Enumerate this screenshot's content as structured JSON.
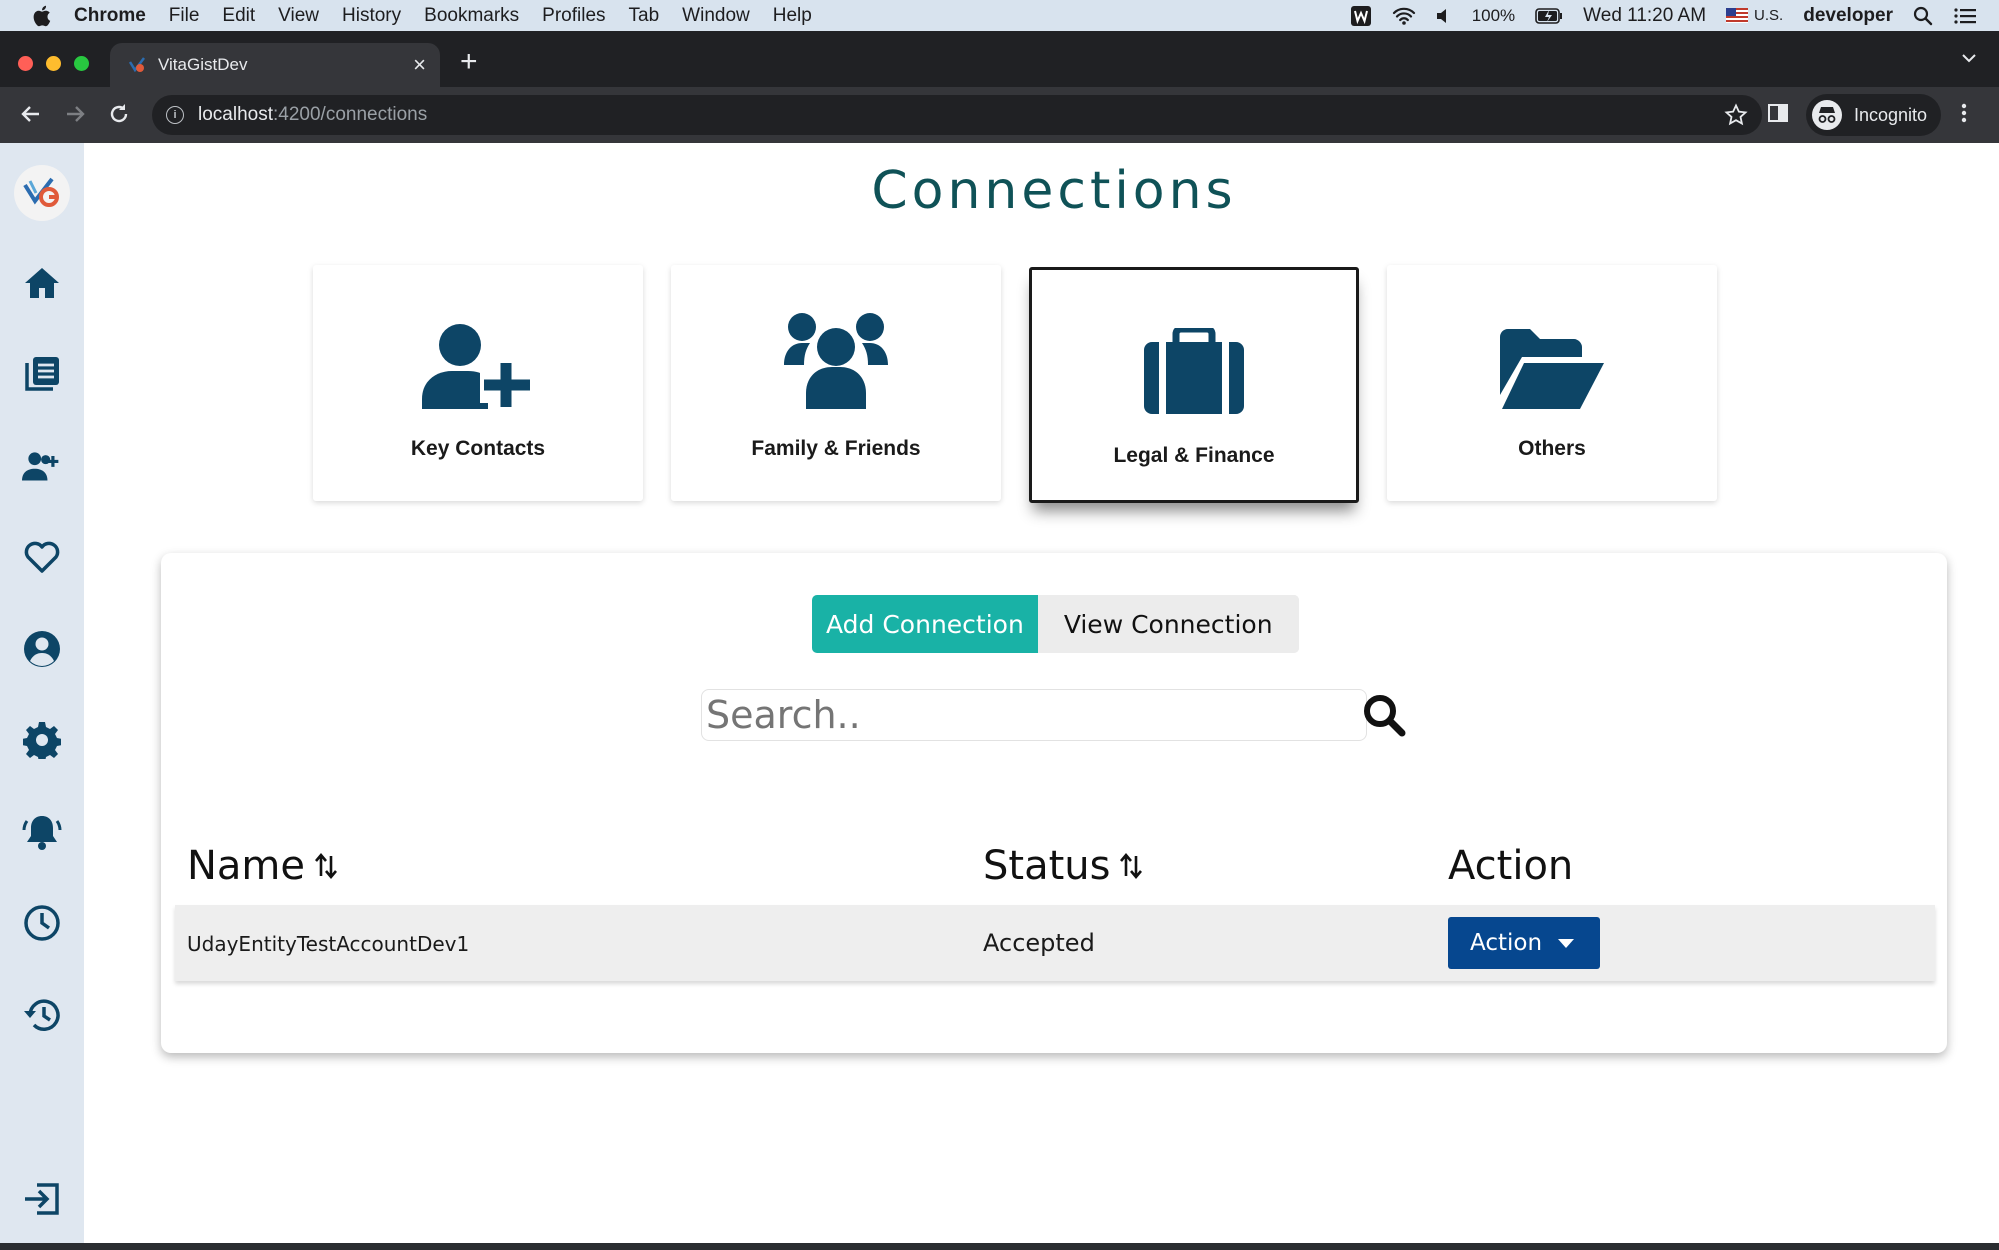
{
  "menubar": {
    "app": "Chrome",
    "items": [
      "File",
      "Edit",
      "View",
      "History",
      "Bookmarks",
      "Profiles",
      "Tab",
      "Window",
      "Help"
    ],
    "battery": "100%",
    "clock": "Wed 11:20 AM",
    "input_source": "U.S.",
    "user": "developer"
  },
  "browser": {
    "tab_title": "VitaGistDev",
    "url_host": "localhost",
    "url_path": ":4200/connections",
    "profile_label": "Incognito"
  },
  "page": {
    "title": "Connections",
    "categories": [
      {
        "label": "Key Contacts",
        "icon": "user-plus-icon"
      },
      {
        "label": "Family & Friends",
        "icon": "users-icon"
      },
      {
        "label": "Legal & Finance",
        "icon": "briefcase-icon",
        "selected": true
      },
      {
        "label": "Others",
        "icon": "folder-open-icon"
      }
    ],
    "toggle": {
      "add_label": "Add Connection",
      "view_label": "View Connection",
      "active": "Add Connection"
    },
    "search": {
      "placeholder": "Search.."
    },
    "table": {
      "headers": {
        "name": "Name",
        "status": "Status",
        "action": "Action"
      },
      "rows": [
        {
          "name": "UdayEntityTestAccountDev1",
          "status": "Accepted",
          "action_label": "Action"
        }
      ]
    }
  },
  "colors": {
    "accent": "#19b2a6",
    "primary": "#06478f",
    "icon": "#0d4566",
    "title": "#0f5257",
    "sidebar": "#dfe7f0"
  }
}
